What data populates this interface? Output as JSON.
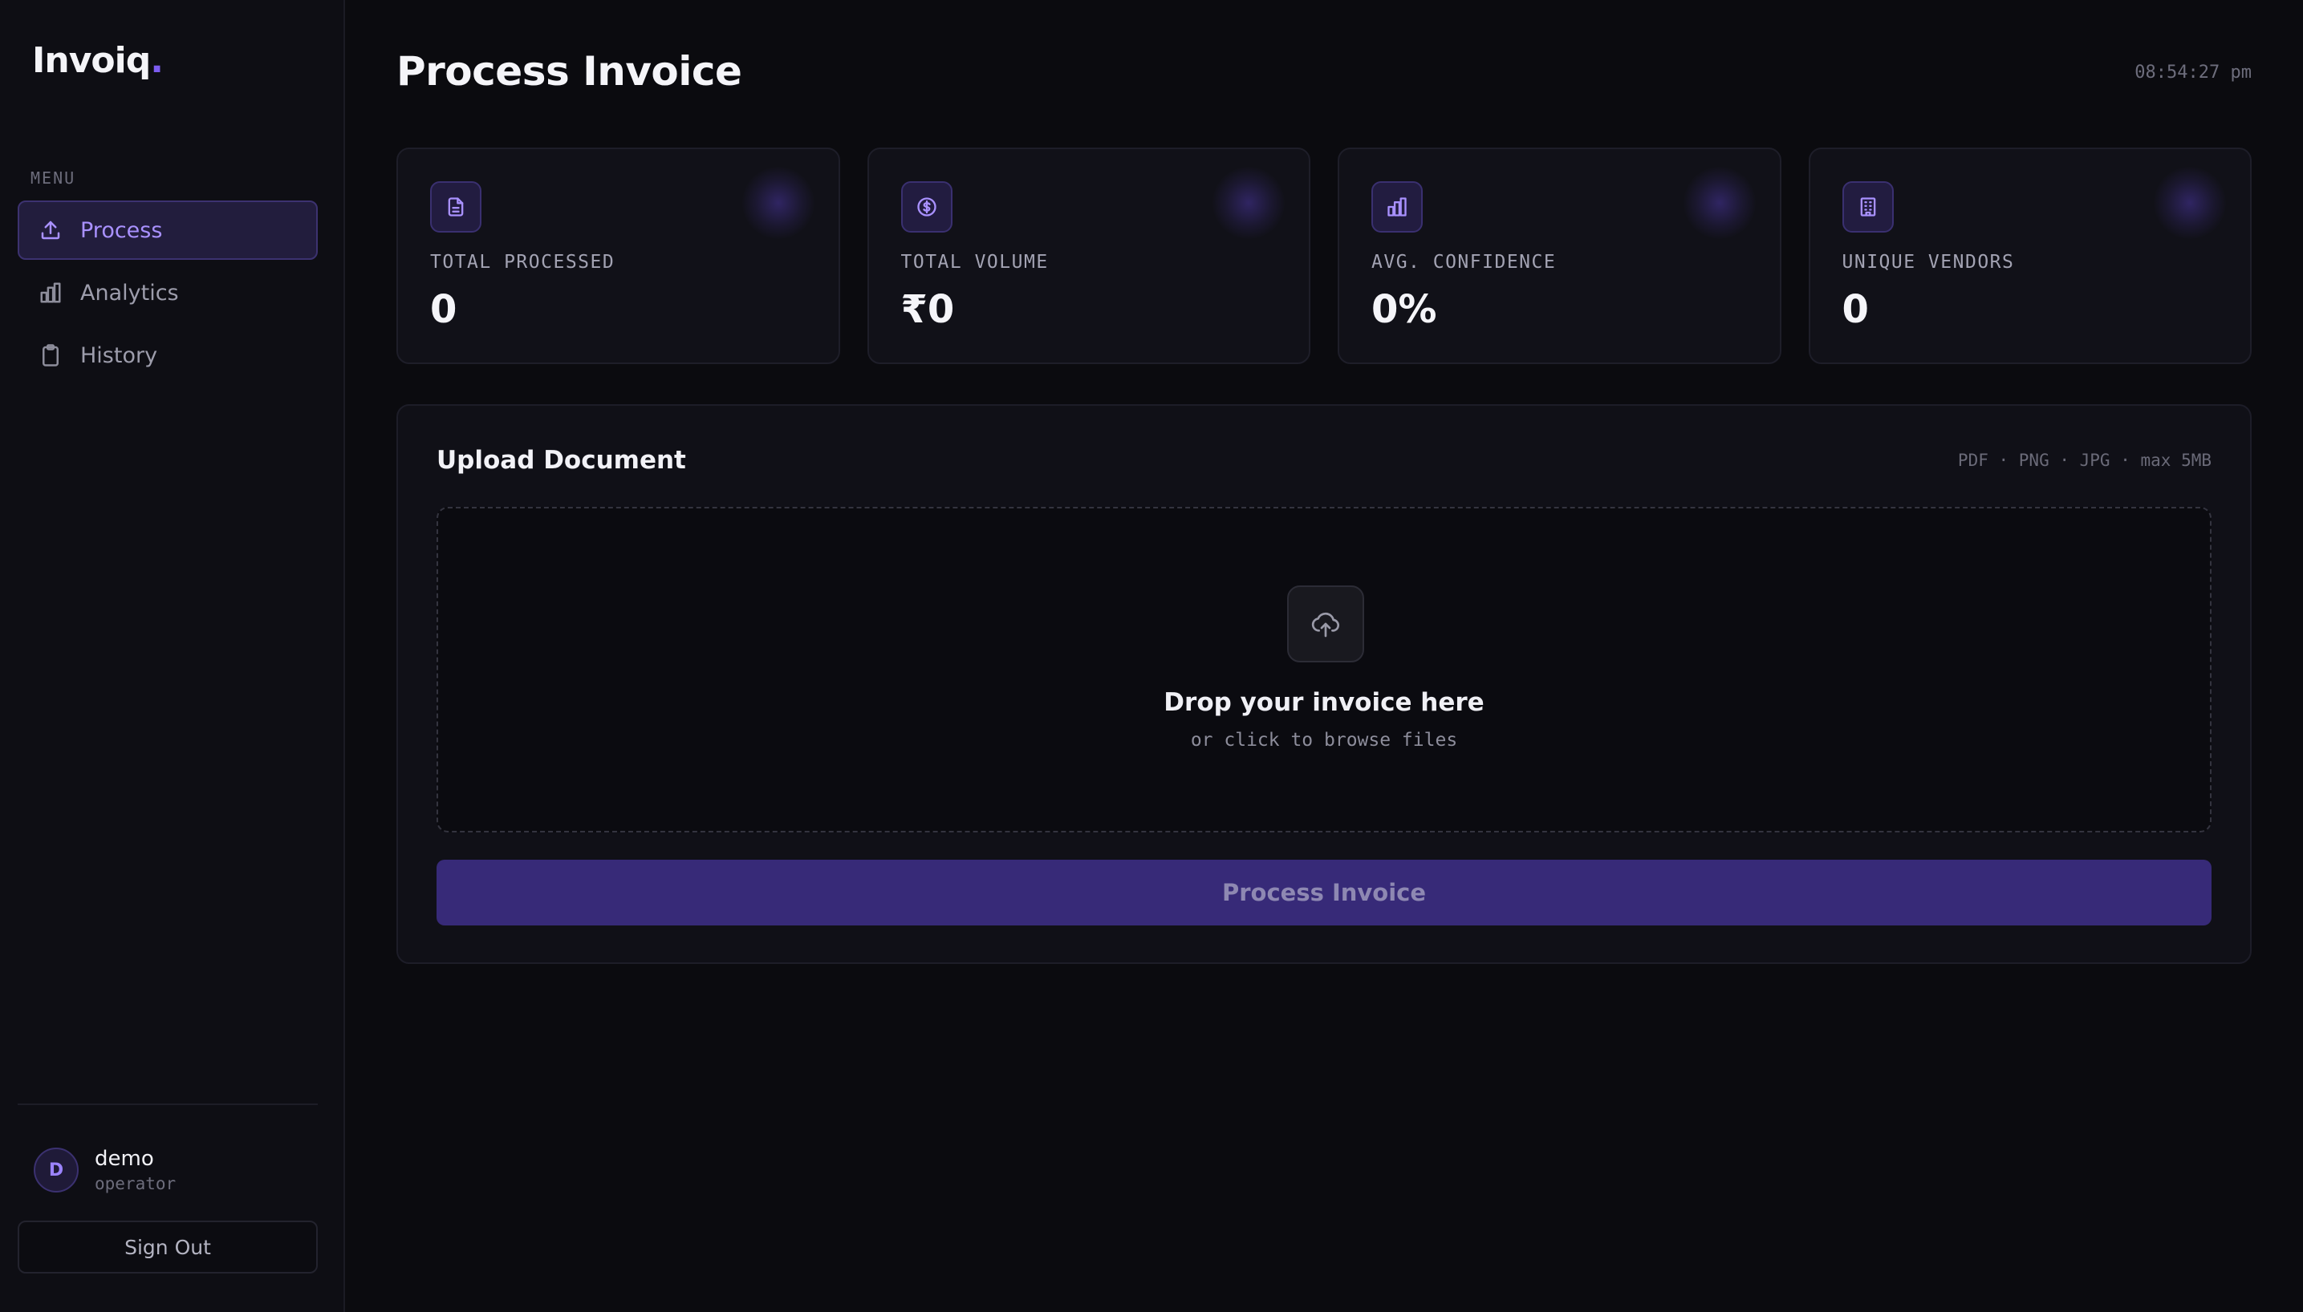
{
  "sidebar": {
    "logo": "Invoiq",
    "logo_dot": ".",
    "menu_label": "MENU",
    "items": [
      {
        "label": "Process",
        "icon": "upload-icon",
        "active": true
      },
      {
        "label": "Analytics",
        "icon": "bar-chart-icon",
        "active": false
      },
      {
        "label": "History",
        "icon": "clipboard-icon",
        "active": false
      }
    ],
    "user": {
      "initial": "D",
      "name": "demo",
      "role": "operator"
    },
    "signout_label": "Sign Out"
  },
  "header": {
    "title": "Process Invoice",
    "clock": "08:54:27 pm"
  },
  "stats": [
    {
      "label": "TOTAL PROCESSED",
      "value": "0",
      "icon": "document-icon"
    },
    {
      "label": "TOTAL VOLUME",
      "value": "₹0",
      "icon": "dollar-coin-icon"
    },
    {
      "label": "AVG. CONFIDENCE",
      "value": "0%",
      "icon": "bar-chart-icon"
    },
    {
      "label": "UNIQUE VENDORS",
      "value": "0",
      "icon": "building-icon"
    }
  ],
  "upload": {
    "title": "Upload Document",
    "formats": "PDF · PNG · JPG · max 5MB",
    "drop_title": "Drop your invoice here",
    "drop_sub": "or click to browse files",
    "button_label": "Process Invoice"
  },
  "colors": {
    "accent": "#7c5cf0",
    "accent_text": "#a991ff",
    "background": "#0b0b0f",
    "button_bg": "#372a78"
  }
}
